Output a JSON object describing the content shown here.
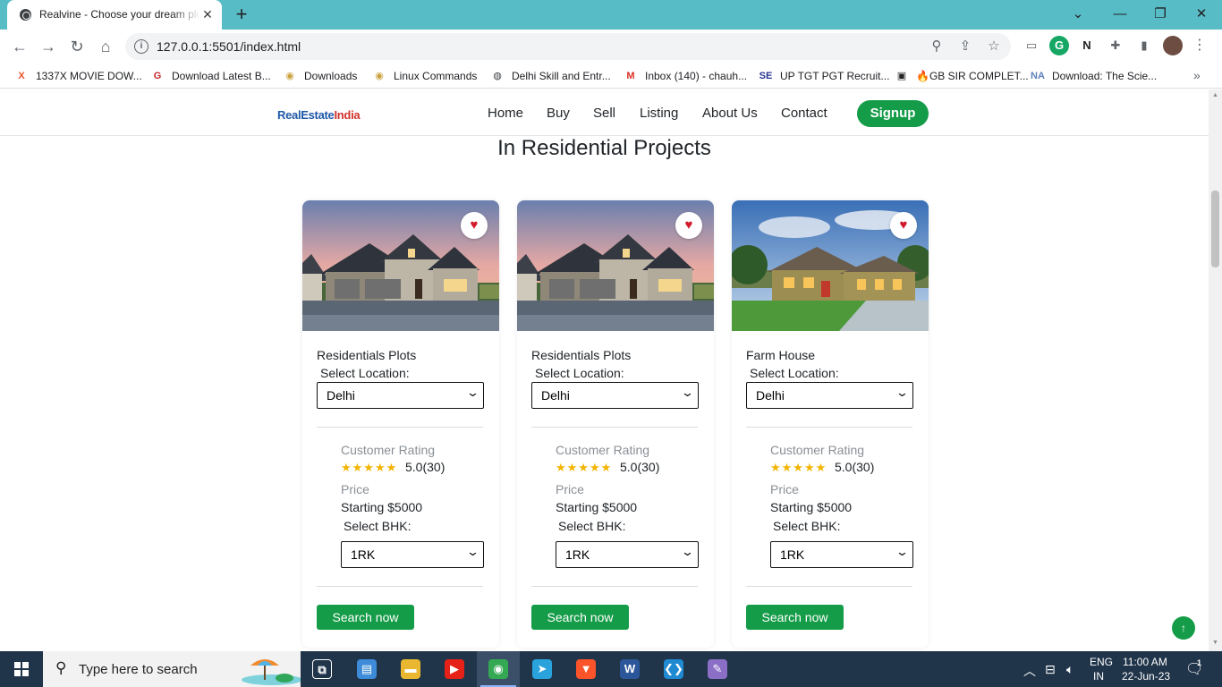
{
  "browser": {
    "tab_title": "Realvine - Choose your dream plot",
    "tab_close": "✕",
    "new_tab": "+",
    "url": "127.0.0.1:5501/index.html",
    "window_controls": {
      "minimize": "—",
      "maximize": "❐",
      "close": "✕",
      "tab_search": "⌄"
    }
  },
  "bookmarks": [
    {
      "label": "1337X MOVIE DOW...",
      "icon": "x-icon",
      "glyph": "X",
      "color": "#e8542c"
    },
    {
      "label": "Download Latest B...",
      "icon": "g-logo-icon",
      "glyph": "G",
      "color": "#c62828"
    },
    {
      "label": "Downloads",
      "icon": "disc-icon",
      "glyph": "◉",
      "color": "#c9a13c"
    },
    {
      "label": "Linux Commands",
      "icon": "disc-icon",
      "glyph": "◉",
      "color": "#c9a13c"
    },
    {
      "label": "Delhi Skill and Entr...",
      "icon": "globe-icon",
      "glyph": "◍",
      "color": "#3c4043"
    },
    {
      "label": "Inbox (140) - chauh...",
      "icon": "gmail-icon",
      "glyph": "M",
      "color": "#d93025"
    },
    {
      "label": "UP TGT PGT Recruit...",
      "icon": "se-icon",
      "glyph": "SE",
      "color": "#283593"
    },
    {
      "label": "🔥GB SIR COMPLET...",
      "icon": "film-icon",
      "glyph": "▣",
      "color": "#222222"
    },
    {
      "label": "Download: The Scie...",
      "icon": "na-icon",
      "glyph": "NA",
      "color": "#5c7fb8"
    }
  ],
  "bookmarks_more": "»",
  "site": {
    "logo_part1": "RealEstate",
    "logo_part2": "India",
    "nav": [
      "Home",
      "Buy",
      "Sell",
      "Listing",
      "About Us",
      "Contact"
    ],
    "signup": "Signup",
    "section_title": "In Residential Projects",
    "to_top": "↑"
  },
  "cards": [
    {
      "title": "Residentials Plots",
      "location_label": "Select Location:",
      "location_value": "Delhi",
      "rating_label": "Customer Rating",
      "stars": "★★★★★",
      "rating": "5.0(30)",
      "price_label": "Price",
      "price": "Starting $5000",
      "bhk_label": "Select BHK:",
      "bhk_value": "1RK",
      "button": "Search now",
      "favorite": "♥"
    },
    {
      "title": "Residentials Plots",
      "location_label": "Select Location:",
      "location_value": "Delhi",
      "rating_label": "Customer Rating",
      "stars": "★★★★★",
      "rating": "5.0(30)",
      "price_label": "Price",
      "price": "Starting $5000",
      "bhk_label": "Select BHK:",
      "bhk_value": "1RK",
      "button": "Search now",
      "favorite": "♥"
    },
    {
      "title": "Farm House",
      "location_label": "Select Location:",
      "location_value": "Delhi",
      "rating_label": "Customer Rating",
      "stars": "★★★★★",
      "rating": "5.0(30)",
      "price_label": "Price",
      "price": "Starting $5000",
      "bhk_label": "Select BHK:",
      "bhk_value": "1RK",
      "button": "Search now",
      "favorite": "♥"
    }
  ],
  "taskbar": {
    "search_placeholder": "Type here to search",
    "apps": [
      {
        "name": "task-view",
        "glyph": "⧉",
        "color": "#20344a"
      },
      {
        "name": "news",
        "glyph": "▤",
        "color": "#3d8bd9"
      },
      {
        "name": "file-explorer",
        "glyph": "▬",
        "color": "#e9b730"
      },
      {
        "name": "youtube",
        "glyph": "▶",
        "color": "#e62117"
      },
      {
        "name": "chrome",
        "glyph": "◉",
        "color": "#34a853"
      },
      {
        "name": "telegram",
        "glyph": "➤",
        "color": "#2aa3dd"
      },
      {
        "name": "brave",
        "glyph": "▼",
        "color": "#fb542b"
      },
      {
        "name": "word",
        "glyph": "W",
        "color": "#2b579a"
      },
      {
        "name": "vscode",
        "glyph": "❮❯",
        "color": "#1f8ad2"
      },
      {
        "name": "paint",
        "glyph": "✎",
        "color": "#8b6fc7"
      }
    ],
    "language": "ENG",
    "region": "IN",
    "time": "11:00 AM",
    "date": "22-Jun-23",
    "notifications": "1"
  }
}
